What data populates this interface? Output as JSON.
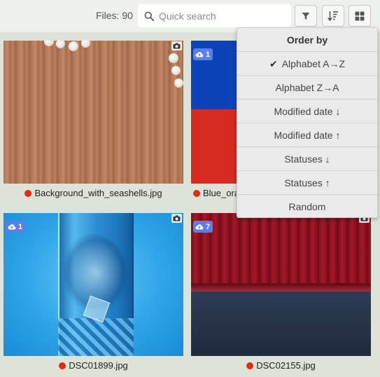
{
  "toolbar": {
    "files_count": "Files: 90",
    "search_placeholder": "Quick search",
    "icons": {
      "search": "search-icon",
      "filter": "filter-icon",
      "sort": "sort-icon",
      "view": "grid-view-icon"
    }
  },
  "order_menu": {
    "title": "Order by",
    "items": [
      {
        "label": "Alphabet A→Z",
        "selected": true
      },
      {
        "label": "Alphabet Z→A",
        "selected": false
      },
      {
        "label": "Modified date ↓",
        "selected": false
      },
      {
        "label": "Modified date ↑",
        "selected": false
      },
      {
        "label": "Statuses ↓",
        "selected": false
      },
      {
        "label": "Statuses ↑",
        "selected": false
      },
      {
        "label": "Random",
        "selected": false
      }
    ]
  },
  "cards": [
    {
      "filename": "Background_with_seashells.jpg",
      "cloud_count": "",
      "status_color": "#e8290e"
    },
    {
      "filename": "Blue_ora",
      "cloud_count": "1",
      "status_color": "#e8290e"
    },
    {
      "filename": "DSC01899.jpg",
      "cloud_count": "1",
      "status_color": "#e8290e"
    },
    {
      "filename": "DSC02155.jpg",
      "cloud_count": "7",
      "status_color": "#e8290e"
    }
  ],
  "colors": {
    "accent_badge": "#5b7ee8",
    "status_dot": "#e8290e",
    "background": "#dde3d8"
  }
}
